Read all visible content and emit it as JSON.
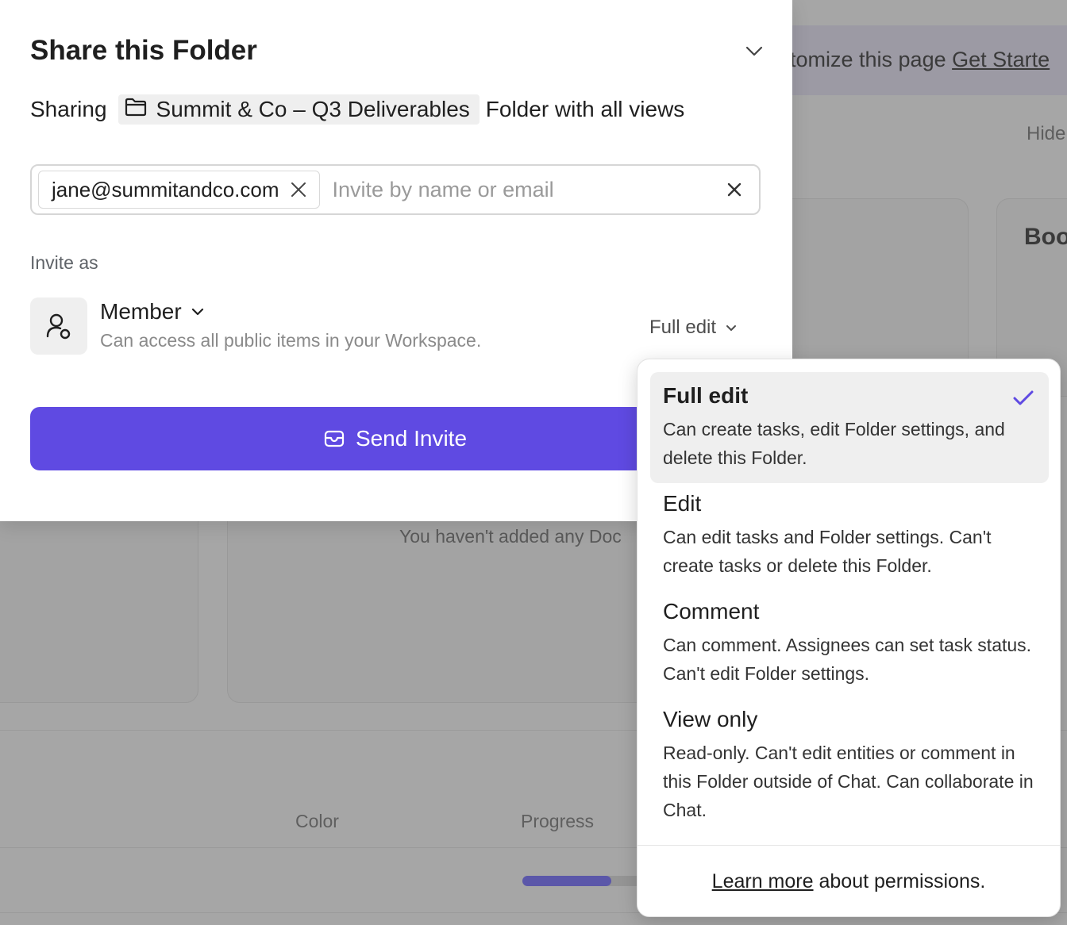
{
  "background": {
    "banner_text": "tomize this page",
    "banner_link": "Get Starte",
    "hide_label": "Hide",
    "card_title": "Boo",
    "empty_text": "You haven't added any Doc",
    "columns": {
      "color": "Color",
      "progress": "Progress"
    },
    "progress_fraction": 0.62
  },
  "modal": {
    "title": "Share this Folder",
    "sharing_prefix": "Sharing",
    "folder_name": "Summit & Co – Q3 Deliverables",
    "sharing_suffix": "Folder with all views",
    "invitee_email": "jane@summitandco.com",
    "invite_placeholder": "Invite by name or email",
    "invite_as_label": "Invite as",
    "role_name": "Member",
    "role_description": "Can access all public items in your Workspace.",
    "permission_selected": "Full edit",
    "send_button_label": "Send Invite"
  },
  "permission_menu": {
    "options": [
      {
        "title": "Full edit",
        "description": "Can create tasks, edit Folder settings, and delete this Folder.",
        "selected": true
      },
      {
        "title": "Edit",
        "description": "Can edit tasks and Folder settings. Can't create tasks or delete this Folder.",
        "selected": false
      },
      {
        "title": "Comment",
        "description": "Can comment. Assignees can set task status. Can't edit Folder settings.",
        "selected": false
      },
      {
        "title": "View only",
        "description": "Read-only. Can't edit entities or comment in this Folder outside of Chat. Can collaborate in Chat.",
        "selected": false
      }
    ],
    "footer_link": "Learn more",
    "footer_text": " about permissions."
  },
  "colors": {
    "accent": "#5f4ae2",
    "check": "#5f4ae2"
  }
}
